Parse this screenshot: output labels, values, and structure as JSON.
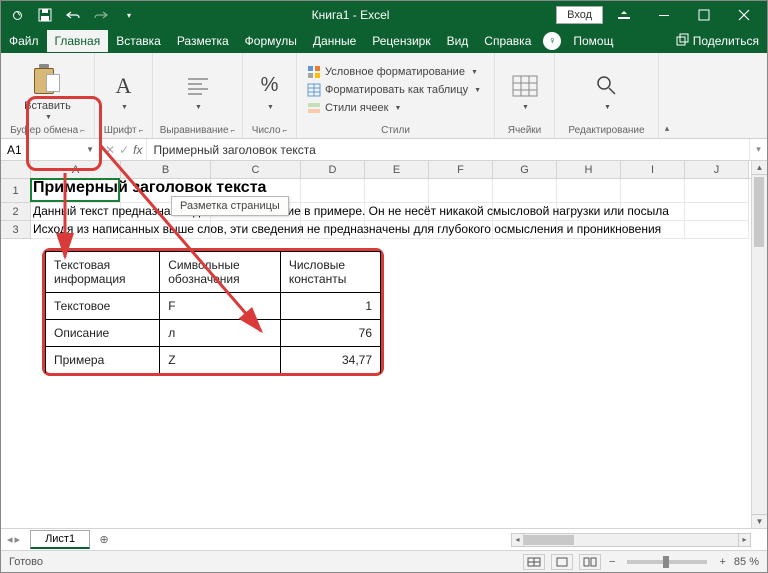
{
  "title": {
    "app": "Книга1 - Excel",
    "login": "Вход"
  },
  "tabs": {
    "file": "Файл",
    "home": "Главная",
    "insert": "Вставка",
    "layout": "Разметка",
    "formulas": "Формулы",
    "data": "Данные",
    "review": "Рецензирк",
    "view": "Вид",
    "help": "Справка",
    "tellme": "Помощ",
    "share": "Поделиться"
  },
  "ribbon": {
    "paste": "Вставить",
    "clipboard": "Буфер обмена",
    "font": "Шрифт",
    "alignment": "Выравнивание",
    "number": "Число",
    "cond_format": "Условное форматирование",
    "format_table": "Форматировать как таблицу",
    "cell_styles": "Стили ячеек",
    "styles": "Стили",
    "cells": "Ячейки",
    "editing": "Редактирование"
  },
  "tooltip": "Разметка страницы",
  "namebox": "A1",
  "formula": "Примерный заголовок текста",
  "cols": [
    "A",
    "B",
    "C",
    "D",
    "E",
    "F",
    "G",
    "H",
    "I",
    "J"
  ],
  "rows": [
    "1",
    "2",
    "3"
  ],
  "sheet": {
    "title": "Примерный заголовок текста",
    "line2": "Данный текст предназначен для использование в примере. Он не несёт никакой смысловой нагрузки или посыла",
    "line3": "Исходя из написанных выше слов, эти сведения не предназначены для глубокого осмысления и проникновения"
  },
  "table": {
    "h1": "Текстовая информация",
    "h2": "Символьные обозначения",
    "h3": "Числовые константы",
    "r1c1": "Текстовое",
    "r1c2": "F",
    "r1c3": "1",
    "r2c1": "Описание",
    "r2c2": "л",
    "r2c3": "76",
    "r3c1": "Примера",
    "r3c2": "Z",
    "r3c3": "34,77"
  },
  "sheettab": "Лист1",
  "status": {
    "ready": "Готово",
    "zoom": "85 %"
  }
}
